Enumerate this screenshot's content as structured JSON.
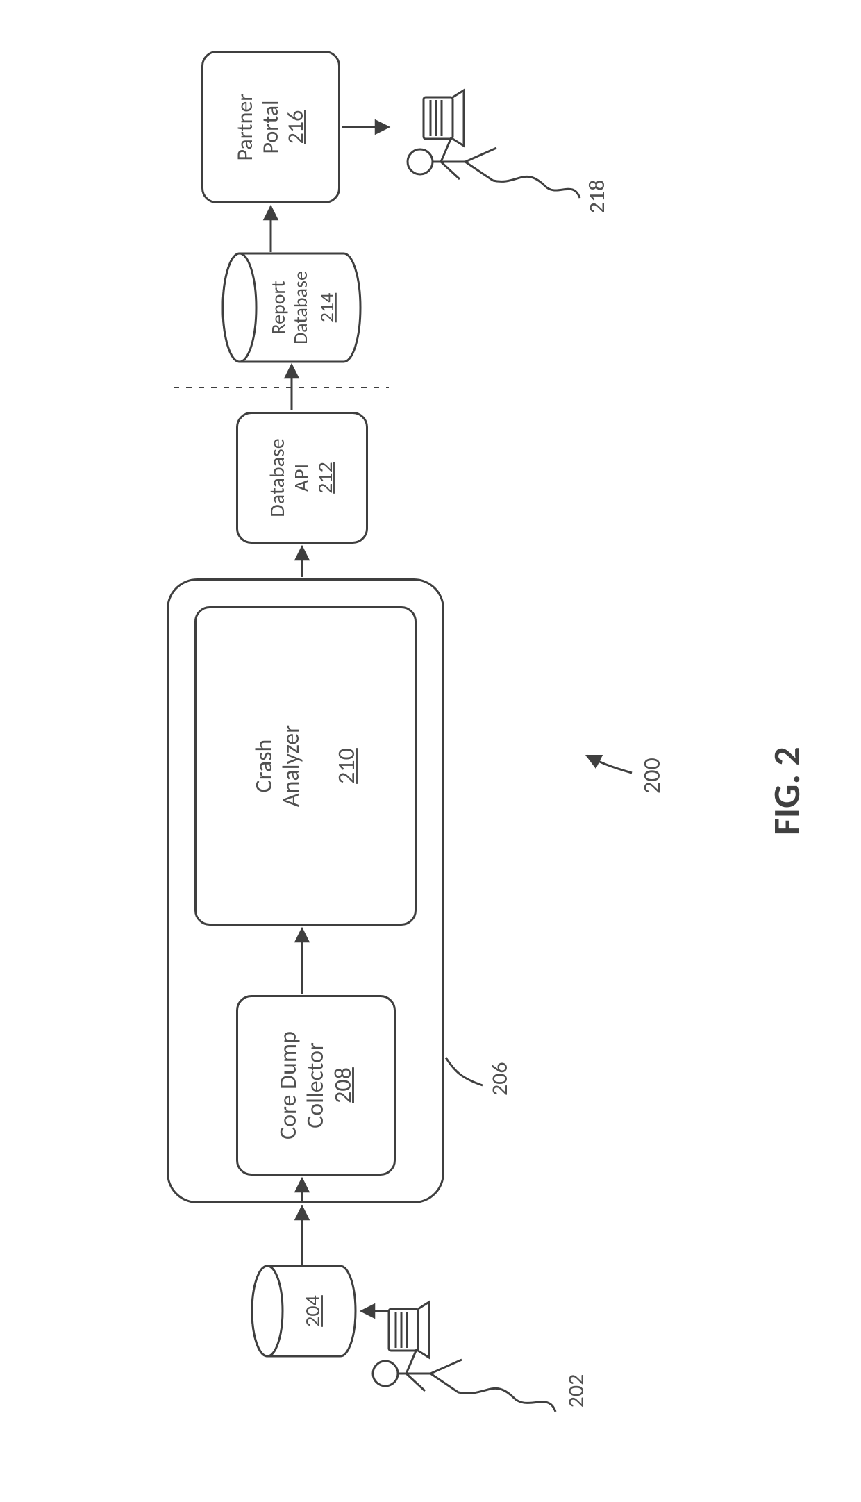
{
  "figure": {
    "label": "FIG. 2",
    "ref_overall": "200"
  },
  "refs": {
    "user_left": "202",
    "db_left": "204",
    "container": "206",
    "collector": "208",
    "analyzer": "210",
    "db_api": "212",
    "report_db": "214",
    "portal": "216",
    "user_right": "218"
  },
  "labels": {
    "collector_line1": "Core Dump",
    "collector_line2": "Collector",
    "analyzer_line1": "Crash",
    "analyzer_line2": "Analyzer",
    "db_api_line1": "Database",
    "db_api_line2": "API",
    "report_db_line1": "Report",
    "report_db_line2": "Database",
    "portal_line1": "Partner",
    "portal_line2": "Portal"
  }
}
